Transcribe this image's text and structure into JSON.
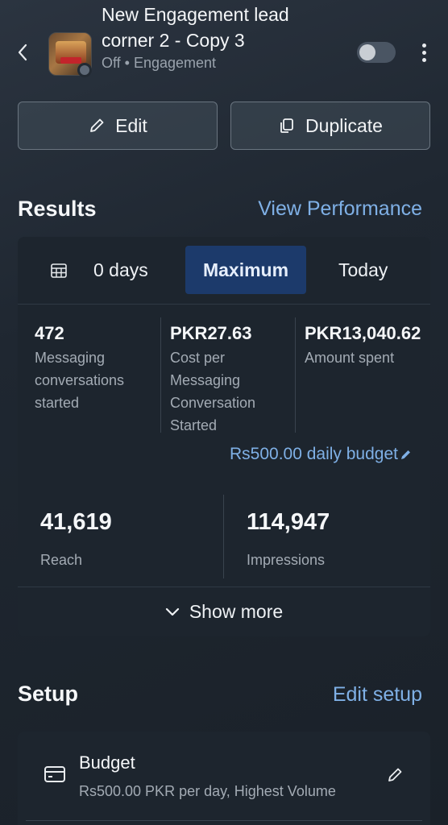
{
  "header": {
    "title": "New Engagement lead corner 2 - Copy 3",
    "status": "Off • Engagement",
    "toggle_on": false
  },
  "actions": {
    "edit_label": "Edit",
    "duplicate_label": "Duplicate"
  },
  "results": {
    "title": "Results",
    "link": "View Performance",
    "filters": {
      "days": "0 days",
      "selected": "Maximum",
      "today": "Today"
    },
    "metrics": [
      {
        "value": "472",
        "label": "Messaging conversations started"
      },
      {
        "value": "PKR27.63",
        "label": "Cost per Messaging Conversation Started"
      },
      {
        "value": "PKR13,040.62",
        "label": "Amount spent"
      }
    ],
    "budget": "Rs500.00 daily budget",
    "reach": {
      "value": "41,619",
      "label": "Reach"
    },
    "impressions": {
      "value": "114,947",
      "label": "Impressions"
    },
    "show_more": "Show more"
  },
  "setup": {
    "title": "Setup",
    "link": "Edit setup",
    "budget_title": "Budget",
    "budget_desc": "Rs500.00 PKR per day, Highest Volume"
  },
  "colors": {
    "accent_link": "#7fb0e6",
    "selected_pill": "#1c3a6b"
  }
}
